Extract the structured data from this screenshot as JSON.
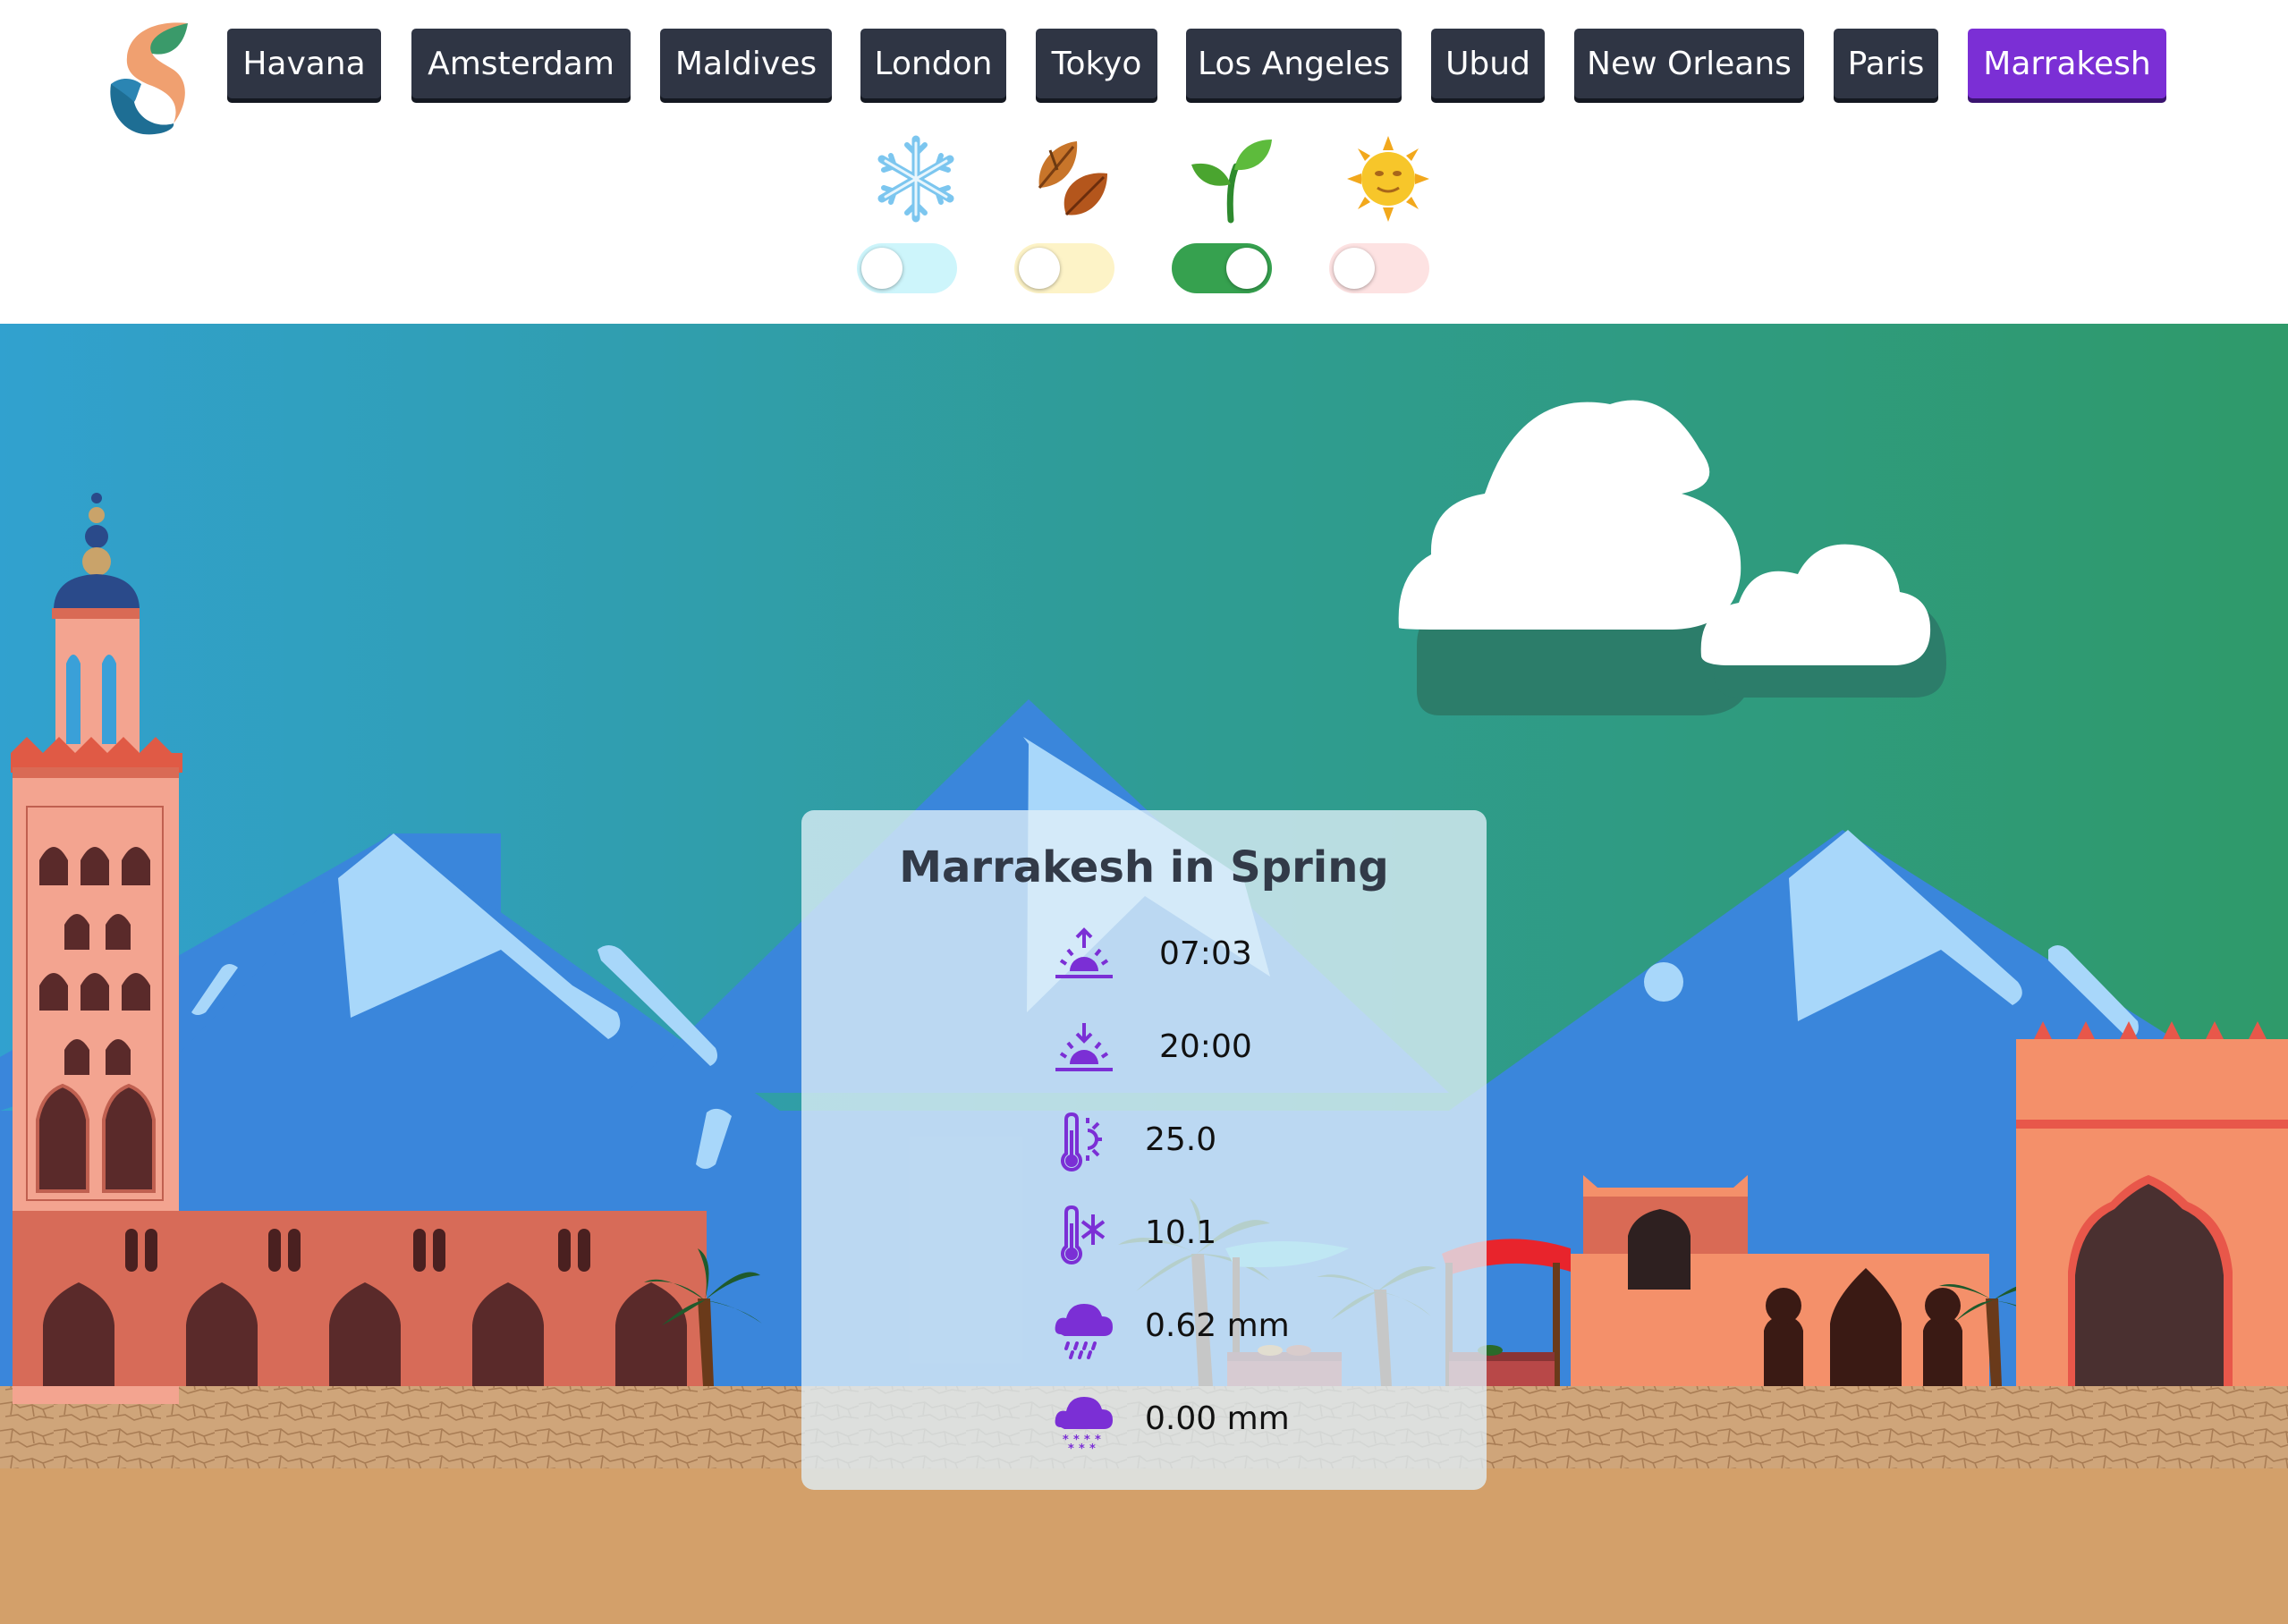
{
  "nav": {
    "cities": [
      {
        "label": "Havana",
        "active": false
      },
      {
        "label": "Amsterdam",
        "active": false
      },
      {
        "label": "Maldives",
        "active": false
      },
      {
        "label": "London",
        "active": false
      },
      {
        "label": "Tokyo",
        "active": false
      },
      {
        "label": "Los Angeles",
        "active": false
      },
      {
        "label": "Ubud",
        "active": false
      },
      {
        "label": "New Orleans",
        "active": false
      },
      {
        "label": "Paris",
        "active": false
      },
      {
        "label": "Marrakesh",
        "active": true
      }
    ]
  },
  "seasons": [
    {
      "name": "winter",
      "icon": "snowflake-icon",
      "on": false,
      "track_color": "#cdf5fb"
    },
    {
      "name": "autumn",
      "icon": "fallen-leaves-icon",
      "on": false,
      "track_color": "#fdf3c7"
    },
    {
      "name": "spring",
      "icon": "seedling-icon",
      "on": true,
      "track_color": "#36a14f"
    },
    {
      "name": "summer",
      "icon": "sun-face-icon",
      "on": false,
      "track_color": "#fde2e2"
    }
  ],
  "card": {
    "title": "Marrakesh in Spring",
    "sunrise": "07:03",
    "sunset": "20:00",
    "temp_max": "25.0",
    "temp_min": "10.1",
    "rain": "0.62 mm",
    "snow": "0.00 mm"
  },
  "colors": {
    "accent": "#7b2fd5",
    "button_dark": "#2f3544",
    "sky_left": "#2fa0d0",
    "sky_right": "#2f9a6a",
    "mountain": "#3b87dc",
    "sand": "#d3a06a",
    "icon_purple": "#7b2fd5"
  }
}
